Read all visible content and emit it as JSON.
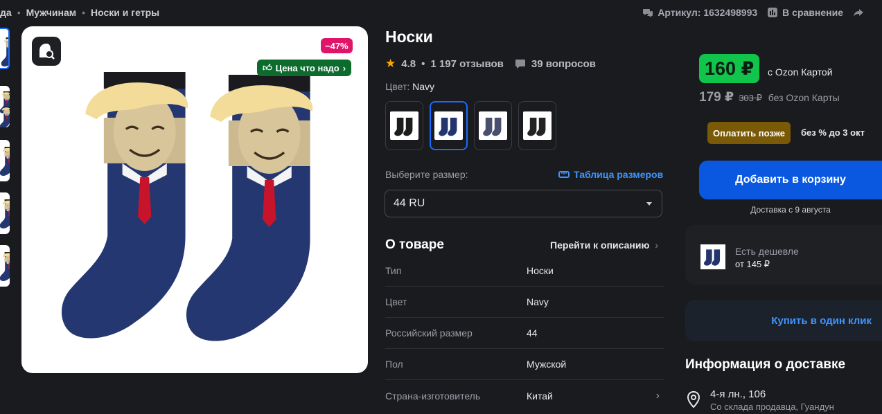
{
  "breadcrumbs": [
    "да",
    "Мужчинам",
    "Носки и гетры"
  ],
  "header": {
    "article": "Артикул: 1632498993",
    "compare": "В сравнение"
  },
  "badges": {
    "discount": "−47%",
    "good_price": "Цена что надо"
  },
  "product": {
    "title": "Носки",
    "rating": "4.8",
    "reviews": "1 197 отзывов",
    "questions": "39 вопросов",
    "color_label": "Цвет:",
    "color_value": "Navy",
    "swatch_colors": [
      "#1c1c1c",
      "#24356d",
      "#4a4f6b",
      "#232323"
    ],
    "size_label": "Выберите размер:",
    "size_table": "Таблица размеров",
    "size_selected": "44 RU"
  },
  "about": {
    "title": "О товаре",
    "go_to_description": "Перейти к описанию",
    "specs": [
      {
        "key": "Тип",
        "value": "Носки"
      },
      {
        "key": "Цвет",
        "value": "Navy"
      },
      {
        "key": "Российский размер",
        "value": "44"
      },
      {
        "key": "Пол",
        "value": "Мужской"
      },
      {
        "key": "Страна-изготовитель",
        "value": "Китай"
      }
    ]
  },
  "buy": {
    "card_price": "160 ₽",
    "with_card": "с Ozon Картой",
    "price": "179 ₽",
    "old_price": "303 ₽",
    "without_card": "без Ozon Карты",
    "pay_later": "Оплатить позже",
    "no_percent": "без % до 3 окт",
    "add_to_cart": "Добавить в корзину",
    "delivery_date": "Доставка с 9 августа",
    "cheaper_title": "Есть дешевле",
    "cheaper_price": "от 145 ₽",
    "one_click": "Купить в один клик"
  },
  "delivery_info": {
    "title": "Информация о доставке",
    "address": "4-я лн., 106",
    "source": "Со склада продавца, Гуандун"
  },
  "colors": {
    "accent": "#1a6cff",
    "price_green": "#10c44c",
    "discount_pink": "#e0156a",
    "sock_navy": "#253770"
  }
}
